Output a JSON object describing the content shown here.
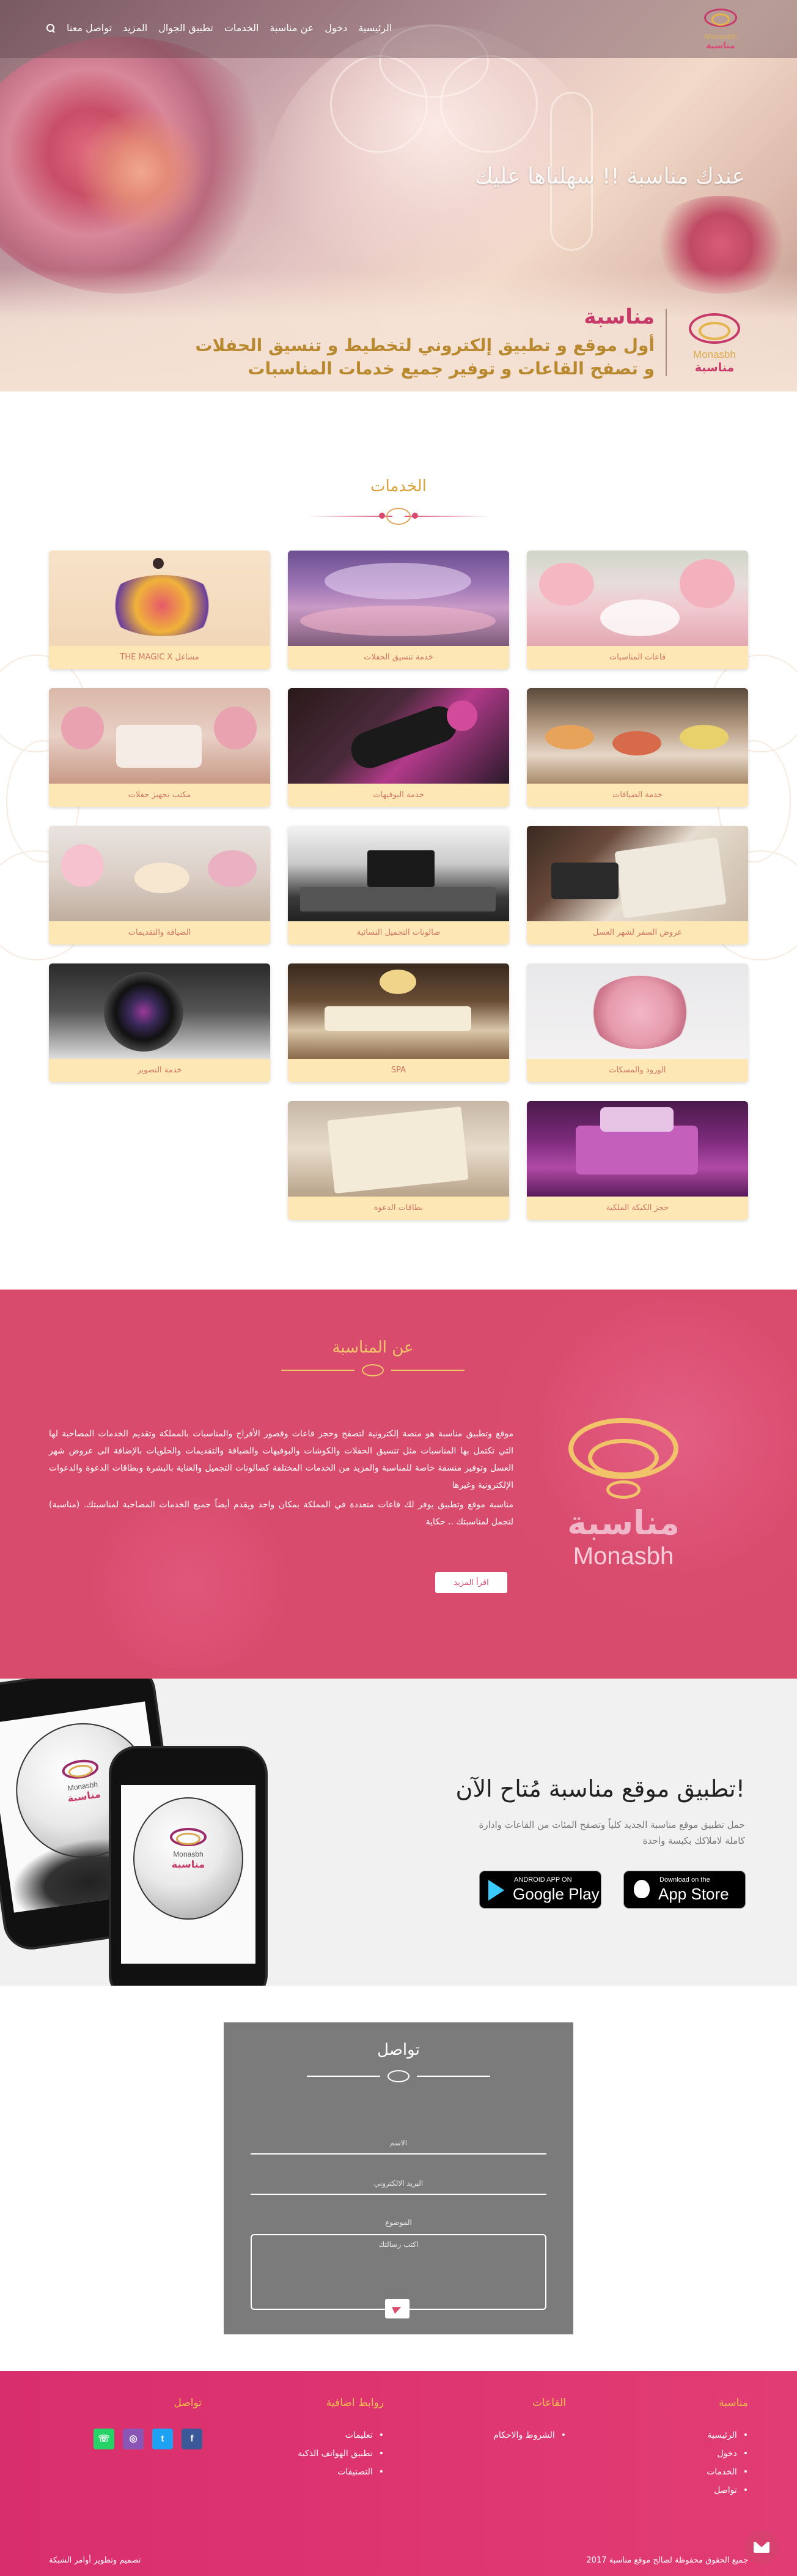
{
  "nav": {
    "logo_en": "Monasbh",
    "logo_ar": "مناسبة",
    "items": [
      "الرئيسية",
      "دخول",
      "عن مناسبة",
      "الخدمات",
      "تطبيق الجوال",
      "المزيد",
      "تواصل معنا"
    ]
  },
  "hero": {
    "tagline": "عندك مناسبة !! سهلناها عليك",
    "brand_title": "مناسبة",
    "brand_line1": "أول موقع و تطبيق إلكتروني لتخطيط و تنسيق الحفلات",
    "brand_line2": "و تصفح القاعات و توفير جميع خدمات المناسبات",
    "logo_en": "Monasbh",
    "logo_ar": "مناسبة"
  },
  "services": {
    "title": "الخدمات",
    "items": [
      {
        "label": "قاعات المناسبات",
        "icon": "wedding-hall-photo"
      },
      {
        "label": "خدمة تنسيق الحفلات",
        "icon": "party-setup-photo"
      },
      {
        "label": "مشاغل THE MAGIC X",
        "icon": "dancer-illustration"
      },
      {
        "label": "خدمة الضيافات",
        "icon": "catering-buffet-photo"
      },
      {
        "label": "خدمة البوفيهات",
        "icon": "perfume-bottle-photo"
      },
      {
        "label": "مكتب تجهيز حفلات",
        "icon": "stage-decor-photo"
      },
      {
        "label": "عروض السفر لشهر العسل",
        "icon": "travel-map-photo"
      },
      {
        "label": "صالونات التجميل النسائية",
        "icon": "salon-interior-photo"
      },
      {
        "label": "الضيافة والتقديمات",
        "icon": "dessert-table-photo"
      },
      {
        "label": "الورود والمسكات",
        "icon": "bouquet-photo"
      },
      {
        "label": "SPA",
        "icon": "spa-room-photo"
      },
      {
        "label": "خدمة التصوير",
        "icon": "camera-lens-photo"
      },
      {
        "label": "حجز الكيكة الملكية",
        "icon": "cake-photo"
      },
      {
        "label": "بطاقات الدعوة",
        "icon": "invitation-card-photo"
      }
    ]
  },
  "about": {
    "title": "عن المناسبة",
    "p1": "موقع وتطبيق مناسبة هو منصة إلكترونية لتصفح وحجز قاعات وقصور الأفراح والمناسبات بالمملكة وتقديم الخدمات المصاحبة لها التي تكتمل بها المناسبات مثل تنسيق الحفلات والكوشات والبوفيهات والضيافة والتقديمات والحلويات بالإضافة الى عروض شهر العسل وتوفير منسقة خاصة للمناسبة والمزيد من الخدمات المختلفة كصالونات التجميل والعناية بالبشرة وبطاقات الدعوة والدعوات الإلكترونية وغيرها",
    "p2": "مناسبة موقع وتطبيق يوفر لك قاعات متعددة في المملكة بمكان واحد ويقدم أيضاً جميع الخدمات المصاحبة لمناسبتك. (مناسبة) لتجمل لمناسبتك .. حكاية",
    "button": "اقرأ المزيد",
    "logo_ar": "مناسبة",
    "logo_en": "Monasbh"
  },
  "app": {
    "title": "!تطبيق موقع مناسبة مُتاح الآن",
    "desc": "حمل تطبيق موقع مناسبة الجديد كلياً وتصفح المئات من القاعات وادارة كاملة لاملاكك بكبسة واحدة",
    "google_small": "ANDROID APP ON",
    "google_big": "Google Play",
    "apple_small": "Download on the",
    "apple_big": "App Store",
    "phone_logo_en": "Monasbh",
    "phone_logo_ar": "مناسبة"
  },
  "contact": {
    "title": "تواصل",
    "name_ph": "الاسم",
    "email_ph": "البريد الالكتروني",
    "subject_ph": "الموضوع",
    "message_ph": "اكتب رسالتك"
  },
  "footer": {
    "col1_title": "مناسبة",
    "col1_items": [
      "الرئيسية",
      "دخول",
      "الخدمات",
      "تواصل"
    ],
    "col2_title": "القاعات",
    "col2_items": [
      "الشروط والاحكام"
    ],
    "col3_title": "روابط اضافية",
    "col3_items": [
      "تعليمات",
      "تطبيق الهواتف الذكية",
      "التصنيفات"
    ],
    "col4_title": "تواصل",
    "social": [
      "f",
      "t",
      "◎",
      "☏"
    ],
    "copyright": "جميع الحقوق محفوظة لصالح موقع مناسبة 2017",
    "developer": "تصميم وتطوير أوامر الشبكة"
  },
  "colors": {
    "primary": "#d94b6d",
    "gold": "#f2c46a",
    "footer": "#e23c74",
    "contact_bg": "#7b7b7b",
    "card_label_bg": "#fde7b4"
  }
}
